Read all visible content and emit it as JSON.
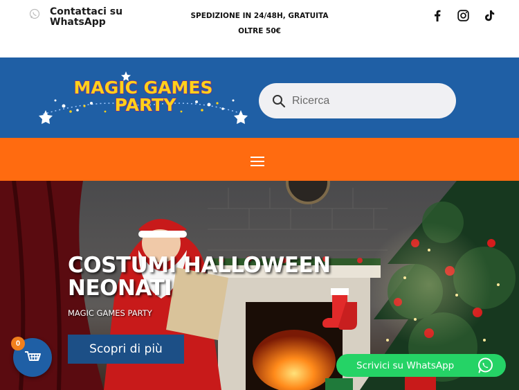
{
  "topbar": {
    "contact_label": "Contattaci su WhatsApp",
    "shipping_line1": "SPEDIZIONE IN 24/48H, GRATUITA",
    "shipping_line2": "OLTRE 50€"
  },
  "header": {
    "logo_text": "MAGIC GAMES PARTY",
    "search_placeholder": "Ricerca"
  },
  "hero": {
    "title": "COSTUMI HALLOWEEN NEONATI",
    "subtitle": "MAGIC GAMES PARTY",
    "button_label": "Scopri di più"
  },
  "cart": {
    "count": "0"
  },
  "whatsapp_chat": {
    "label": "Scrivici su WhatsApp"
  },
  "colors": {
    "header_blue": "#1f5fa5",
    "nav_orange": "#ff6b10",
    "button_blue": "#1c4f86",
    "whatsapp_green": "#25d366",
    "badge_orange": "#f07f1d"
  },
  "icons": [
    "whatsapp-icon",
    "facebook-icon",
    "instagram-icon",
    "tiktok-icon",
    "search-icon",
    "hamburger-menu-icon",
    "cart-icon"
  ]
}
